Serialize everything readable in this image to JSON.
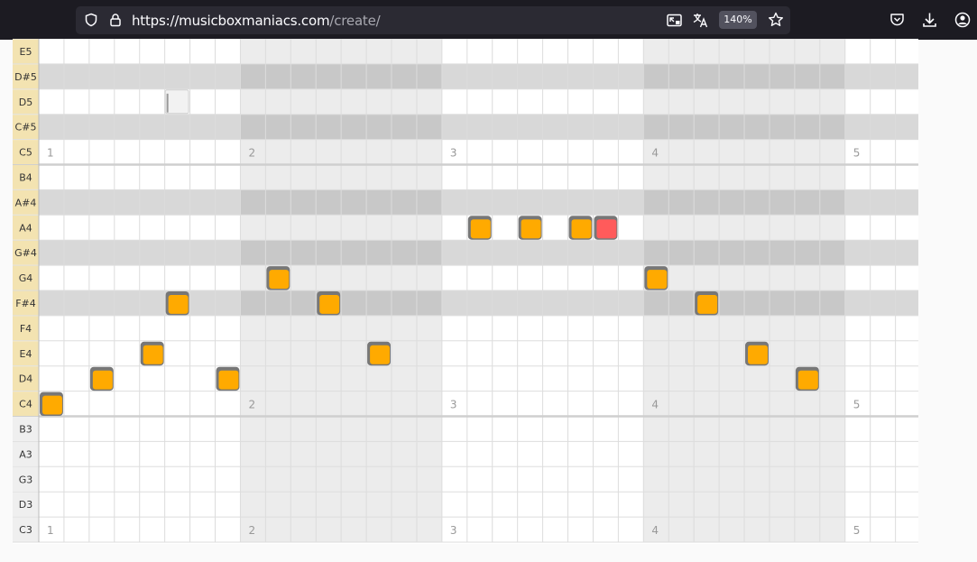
{
  "browser": {
    "url_host": "https://musicboxmaniacs.com",
    "url_path": "/create/",
    "zoom": "140%",
    "icons": [
      "shield-icon",
      "lock-icon",
      "picture-in-picture-icon",
      "translate-icon",
      "bookmark-star-icon",
      "pocket-icon",
      "download-icon",
      "account-icon"
    ]
  },
  "editor": {
    "rows": [
      "E5",
      "D#5",
      "D5",
      "C#5",
      "C5",
      "B4",
      "A#4",
      "A4",
      "G#4",
      "G4",
      "F#4",
      "F4",
      "E4",
      "D4",
      "C4",
      "B3",
      "A3",
      "G3",
      "D3",
      "C3"
    ],
    "sharp_rows": [
      "D#5",
      "C#5",
      "A#4",
      "G#4",
      "F#4"
    ],
    "columns": 35,
    "measure_length": 8,
    "shaded_measures": [
      1,
      3
    ],
    "measure_number_rows": [
      "C5",
      "C4",
      "C3"
    ],
    "measure_numbers": [
      "1",
      "2",
      "3",
      "4",
      "5"
    ],
    "notes": [
      {
        "pitch": "C4",
        "col": 0,
        "state": "placed"
      },
      {
        "pitch": "D4",
        "col": 2,
        "state": "placed"
      },
      {
        "pitch": "E4",
        "col": 4,
        "state": "placed"
      },
      {
        "pitch": "F#4",
        "col": 5,
        "state": "placed"
      },
      {
        "pitch": "D4",
        "col": 7,
        "state": "placed"
      },
      {
        "pitch": "G4",
        "col": 9,
        "state": "placed"
      },
      {
        "pitch": "F#4",
        "col": 11,
        "state": "placed"
      },
      {
        "pitch": "E4",
        "col": 13,
        "state": "placed"
      },
      {
        "pitch": "A4",
        "col": 17,
        "state": "placed"
      },
      {
        "pitch": "A4",
        "col": 19,
        "state": "placed"
      },
      {
        "pitch": "A4",
        "col": 21,
        "state": "placed"
      },
      {
        "pitch": "A4",
        "col": 22,
        "state": "selected"
      },
      {
        "pitch": "G4",
        "col": 24,
        "state": "placed"
      },
      {
        "pitch": "F#4",
        "col": 26,
        "state": "placed"
      },
      {
        "pitch": "E4",
        "col": 28,
        "state": "placed"
      },
      {
        "pitch": "D4",
        "col": 30,
        "state": "placed"
      },
      {
        "pitch": "D5",
        "col": 5,
        "state": "hover"
      }
    ],
    "colors": {
      "note_fill": "#ffaa00",
      "note_border": "#777777",
      "selected_fill": "#ff5b5b",
      "label_bg": "#f3e3b1",
      "label_bg_plain": "#efefef"
    }
  }
}
